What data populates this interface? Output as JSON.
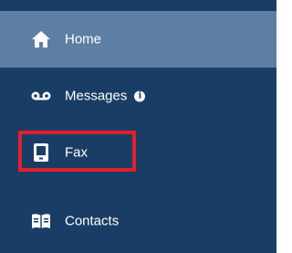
{
  "sidebar": {
    "items": [
      {
        "label": "Home",
        "icon": "home-icon",
        "active": true
      },
      {
        "label": "Messages",
        "icon": "voicemail-icon",
        "info": "i"
      },
      {
        "label": "Fax",
        "icon": "fax-icon"
      },
      {
        "label": "Contacts",
        "icon": "contacts-book-icon"
      }
    ]
  },
  "colors": {
    "sidebar_bg": "#1a3d66",
    "active_bg": "#5e7fa4",
    "highlight_border": "#e0202c",
    "text": "#ffffff"
  }
}
